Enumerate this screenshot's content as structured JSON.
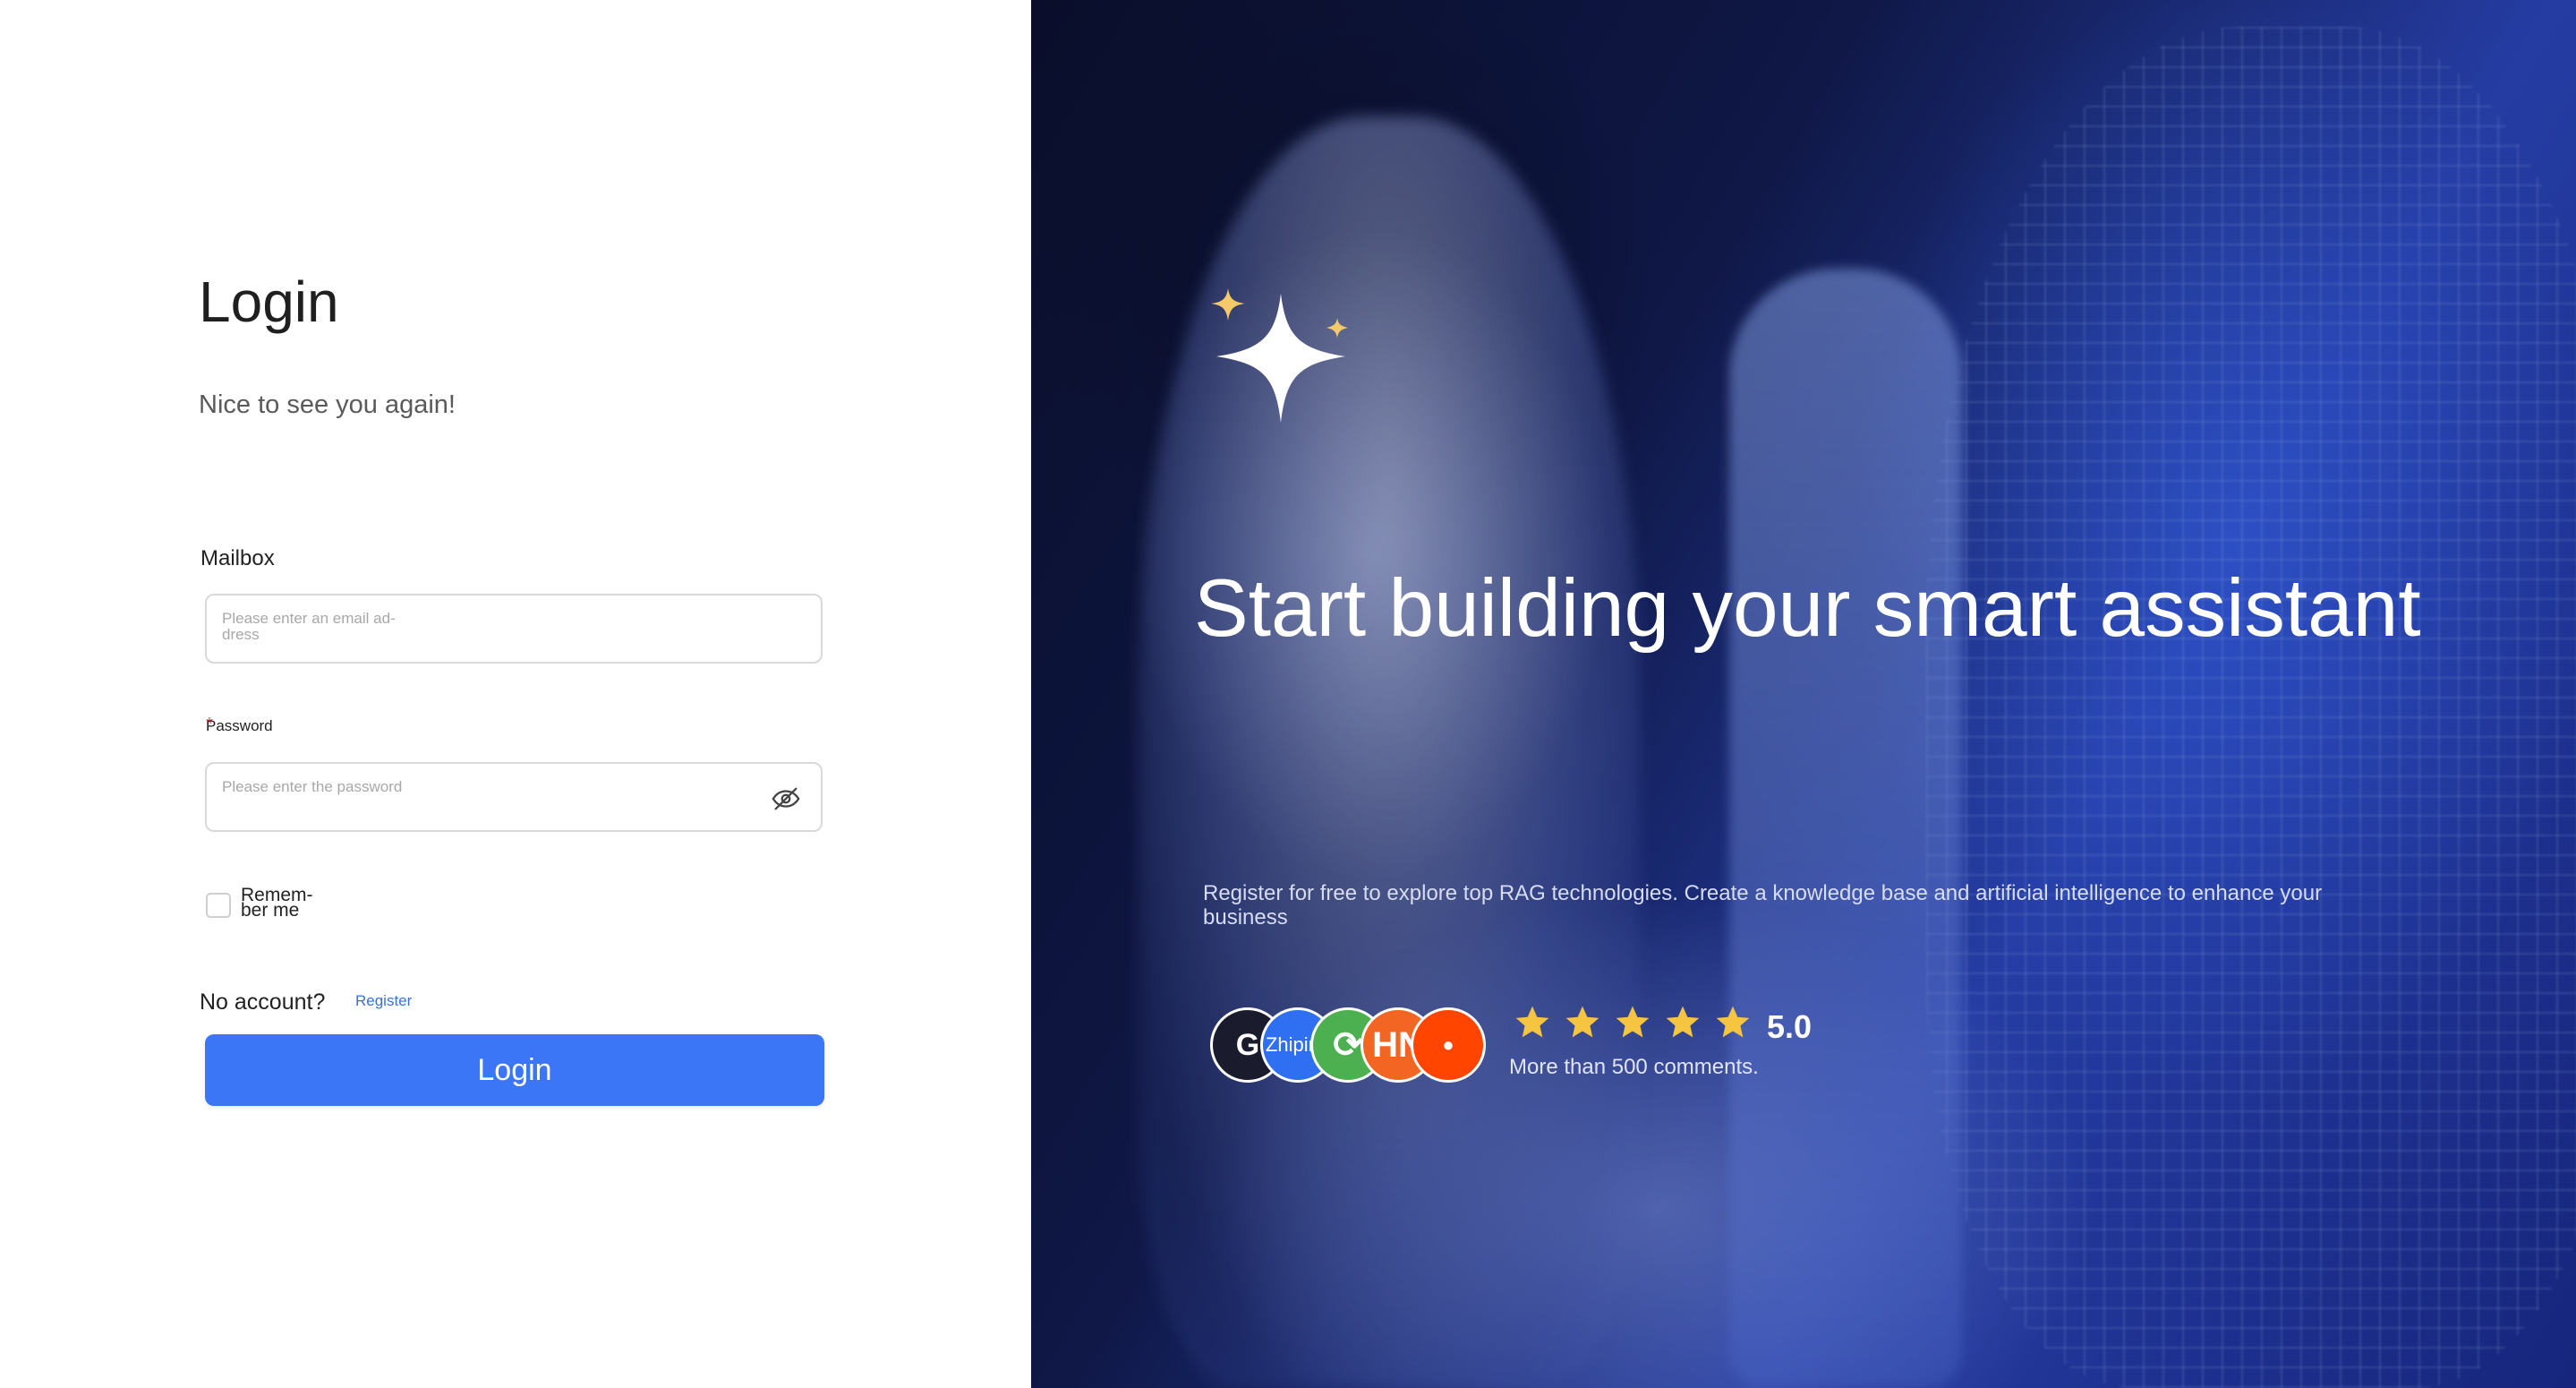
{
  "login": {
    "title": "Login",
    "subtitle": "Nice to see you again!",
    "email_label": "Mailbox",
    "email_placeholder": "Please enter an email ad-dress",
    "password_required_mark": "*",
    "password_label": "Password",
    "password_placeholder": "Please enter the password",
    "remember_label": "Remem-ber me",
    "no_account_text": "No account?",
    "register_link": "Register",
    "login_button": "Login"
  },
  "hero": {
    "headline": "Start building your smart assistant",
    "description": "Register for free to explore top RAG technologies. Create a knowledge base and artificial intelligence to enhance your business",
    "avatars": [
      {
        "name": "github-avatar",
        "text": "G",
        "color": "#1b1b2e"
      },
      {
        "name": "zhiping-avatar",
        "text": "Zhiping",
        "color": "#2f6ff2"
      },
      {
        "name": "refresh-avatar",
        "text": "⟳",
        "color": "#4caf50"
      },
      {
        "name": "hn-avatar",
        "text": "HN",
        "color": "#f26522"
      },
      {
        "name": "reddit-avatar",
        "text": "●",
        "color": "#ff4500"
      }
    ],
    "rating_value": "5.0",
    "rating_stars": 5,
    "comments_text": "More than 500 comments."
  },
  "colors": {
    "primary": "#3b76f6",
    "link": "#3b6fd8",
    "star": "#f5c542",
    "required": "#e5484d"
  }
}
